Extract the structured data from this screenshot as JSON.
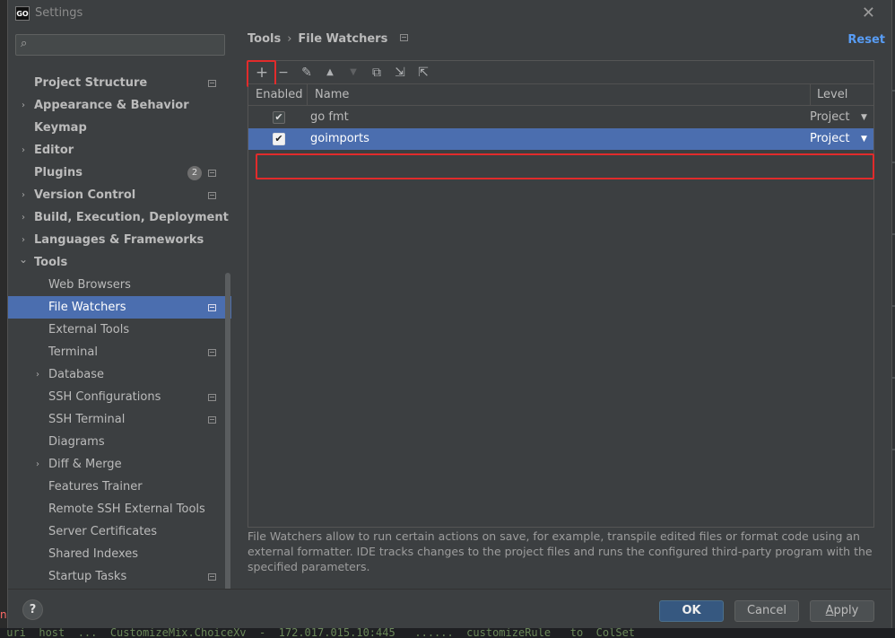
{
  "window": {
    "title": "Settings",
    "app_icon_text": "GO"
  },
  "search": {
    "placeholder": "",
    "value": ""
  },
  "sidebar": {
    "items": [
      {
        "label": "Project Structure",
        "level": 0,
        "expand": "",
        "bold": true,
        "proj": true,
        "badge": ""
      },
      {
        "label": "Appearance & Behavior",
        "level": 0,
        "expand": "›",
        "bold": true,
        "proj": false,
        "badge": ""
      },
      {
        "label": "Keymap",
        "level": 0,
        "expand": "",
        "bold": true,
        "proj": false,
        "badge": ""
      },
      {
        "label": "Editor",
        "level": 0,
        "expand": "›",
        "bold": true,
        "proj": false,
        "badge": ""
      },
      {
        "label": "Plugins",
        "level": 0,
        "expand": "",
        "bold": true,
        "proj": true,
        "badge": "2"
      },
      {
        "label": "Version Control",
        "level": 0,
        "expand": "›",
        "bold": true,
        "proj": true,
        "badge": ""
      },
      {
        "label": "Build, Execution, Deployment",
        "level": 0,
        "expand": "›",
        "bold": true,
        "proj": false,
        "badge": ""
      },
      {
        "label": "Languages & Frameworks",
        "level": 0,
        "expand": "›",
        "bold": true,
        "proj": false,
        "badge": ""
      },
      {
        "label": "Tools",
        "level": 0,
        "expand": "⌄",
        "bold": true,
        "proj": false,
        "badge": ""
      },
      {
        "label": "Web Browsers",
        "level": 1,
        "expand": "",
        "bold": false,
        "proj": false,
        "badge": ""
      },
      {
        "label": "File Watchers",
        "level": 1,
        "expand": "",
        "bold": false,
        "proj": true,
        "badge": "",
        "selected": true
      },
      {
        "label": "External Tools",
        "level": 1,
        "expand": "",
        "bold": false,
        "proj": false,
        "badge": ""
      },
      {
        "label": "Terminal",
        "level": 1,
        "expand": "",
        "bold": false,
        "proj": true,
        "badge": ""
      },
      {
        "label": "Database",
        "level": 1,
        "expand": "›",
        "bold": false,
        "proj": false,
        "badge": ""
      },
      {
        "label": "SSH Configurations",
        "level": 1,
        "expand": "",
        "bold": false,
        "proj": true,
        "badge": ""
      },
      {
        "label": "SSH Terminal",
        "level": 1,
        "expand": "",
        "bold": false,
        "proj": true,
        "badge": ""
      },
      {
        "label": "Diagrams",
        "level": 1,
        "expand": "",
        "bold": false,
        "proj": false,
        "badge": ""
      },
      {
        "label": "Diff & Merge",
        "level": 1,
        "expand": "›",
        "bold": false,
        "proj": false,
        "badge": ""
      },
      {
        "label": "Features Trainer",
        "level": 1,
        "expand": "",
        "bold": false,
        "proj": false,
        "badge": ""
      },
      {
        "label": "Remote SSH External Tools",
        "level": 1,
        "expand": "",
        "bold": false,
        "proj": false,
        "badge": ""
      },
      {
        "label": "Server Certificates",
        "level": 1,
        "expand": "",
        "bold": false,
        "proj": false,
        "badge": ""
      },
      {
        "label": "Shared Indexes",
        "level": 1,
        "expand": "",
        "bold": false,
        "proj": false,
        "badge": ""
      },
      {
        "label": "Startup Tasks",
        "level": 1,
        "expand": "",
        "bold": false,
        "proj": true,
        "badge": ""
      }
    ]
  },
  "breadcrumb": {
    "parent": "Tools",
    "separator": "›",
    "current": "File Watchers"
  },
  "reset_label": "Reset",
  "toolbar": {
    "add": "+",
    "remove": "−",
    "edit": "✎",
    "move_up": "▲",
    "move_down": "▼",
    "copy": "⧉",
    "import": "⇲",
    "export": "⇱"
  },
  "table": {
    "columns": [
      "Enabled",
      "Name",
      "Level"
    ],
    "rows": [
      {
        "enabled": true,
        "name": "go fmt",
        "level": "Project",
        "selected": false
      },
      {
        "enabled": true,
        "name": "goimports",
        "level": "Project",
        "selected": true
      }
    ]
  },
  "description": "File Watchers allow to run certain actions on save, for example, transpile edited files or format code using an external formatter. IDE tracks changes to the project files and runs the configured third-party program with the specified parameters.",
  "footer": {
    "help": "?",
    "ok": "OK",
    "cancel": "Cancel",
    "apply_underlined": "A",
    "apply_rest": "pply"
  },
  "colors": {
    "accent": "#4b6eaf",
    "link": "#589df6",
    "highlight_box": "#e22b2b",
    "dialog_bg": "#3c3f41"
  }
}
